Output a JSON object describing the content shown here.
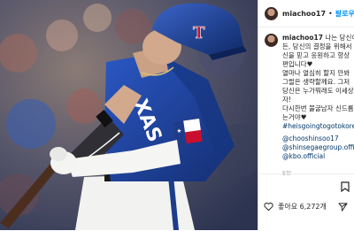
{
  "header": {
    "username": "miachoo17",
    "separator": "•",
    "follow_label": "팔로우"
  },
  "caption": {
    "username": "miachoo17",
    "lines": [
      "나는 당신이",
      "든, 당신의 결정을 위해서",
      "신을 믿고 응원하고 항상",
      "편입니다♥",
      "열마나 열심히 할지 안봐",
      "그럴은 생략할께요. 그저",
      "당신은 누가뭐래도 이세상",
      "자!",
      "다시한번 불굴남자 신드롬",
      "는거야♥"
    ],
    "hashtag": "#heisgoingtogotokorea",
    "mentions": [
      "@chooshinsoo17",
      "@shinsegaegroup.official",
      "@kbo.official"
    ],
    "time": "5일"
  },
  "actions": {
    "likes": "좋아요 6,272개"
  },
  "icons": {
    "heart": "heart-icon",
    "comment": "comment-icon",
    "share": "share-icon",
    "bookmark": "bookmark-icon",
    "avatar": "avatar"
  },
  "photo": {
    "helmet_logo": "T",
    "jersey_text": "XAS"
  },
  "colors": {
    "link": "#0095f6",
    "tag": "#00376b",
    "jersey": "#1c3f94",
    "helmet": "#1d3d8a"
  }
}
